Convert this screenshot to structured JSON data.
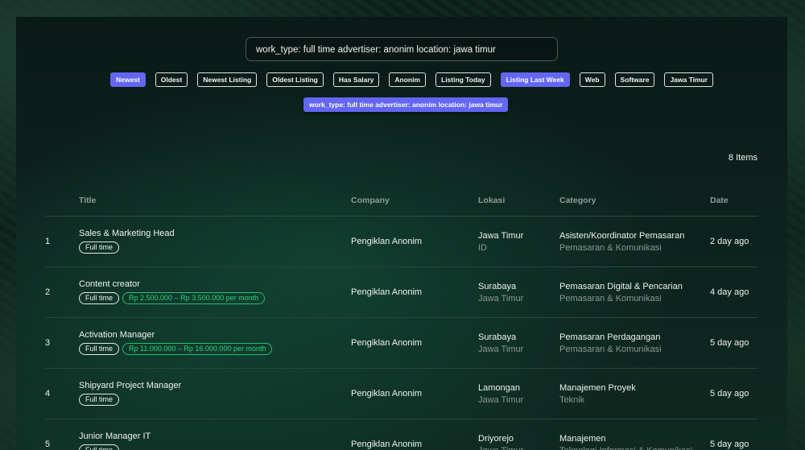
{
  "search": {
    "value": "work_type: full time advertiser: anonim location: jawa timur"
  },
  "chips": [
    {
      "label": "Newest",
      "active": true
    },
    {
      "label": "Oldest",
      "active": false
    },
    {
      "label": "Newest Listing",
      "active": false
    },
    {
      "label": "Oldest Listing",
      "active": false
    },
    {
      "label": "Has Salary",
      "active": false
    },
    {
      "label": "Anonim",
      "active": false
    },
    {
      "label": "Listing Today",
      "active": false
    },
    {
      "label": "Listing Last Week",
      "active": true
    },
    {
      "label": "Web",
      "active": false
    },
    {
      "label": "Software",
      "active": false
    },
    {
      "label": "Jawa Timur",
      "active": false
    }
  ],
  "active_filter": "work_type: full time advertiser: anonim location: jawa timur",
  "items_count": "8 Items",
  "columns": {
    "title": "Title",
    "company": "Company",
    "lokasi": "Lokasi",
    "category": "Category",
    "date": "Date"
  },
  "rows": [
    {
      "num": "1",
      "title": "Sales & Marketing Head",
      "badges": [
        "Full time"
      ],
      "salary": "",
      "company": "Pengiklan Anonim",
      "location": "Jawa Timur",
      "location_sub": "ID",
      "category": "Asisten/Koordinator Pemasaran",
      "category_sub": "Pemasaran & Komunikasi",
      "date": "2 day ago"
    },
    {
      "num": "2",
      "title": "Content creator",
      "badges": [
        "Full time"
      ],
      "salary": "Rp 2.500.000 – Rp 3.500.000 per month",
      "company": "Pengiklan Anonim",
      "location": "Surabaya",
      "location_sub": "Jawa Timur",
      "category": "Pemasaran Digital & Pencarian",
      "category_sub": "Pemasaran & Komunikasi",
      "date": "4 day ago"
    },
    {
      "num": "3",
      "title": "Activation Manager",
      "badges": [
        "Full time"
      ],
      "salary": "Rp 11.000.000 – Rp 16.000.000 per month",
      "company": "Pengiklan Anonim",
      "location": "Surabaya",
      "location_sub": "Jawa Timur",
      "category": "Pemasaran Perdagangan",
      "category_sub": "Pemasaran & Komunikasi",
      "date": "5 day ago"
    },
    {
      "num": "4",
      "title": "Shipyard Project Manager",
      "badges": [
        "Full time"
      ],
      "salary": "",
      "company": "Pengiklan Anonim",
      "location": "Lamongan",
      "location_sub": "Jawa Timur",
      "category": "Manajemen Proyek",
      "category_sub": "Teknik",
      "date": "5 day ago"
    },
    {
      "num": "5",
      "title": "Junior Manager IT",
      "badges": [
        "Full time"
      ],
      "salary": "",
      "company": "Pengiklan Anonim",
      "location": "Driyorejo",
      "location_sub": "Jawa Timur",
      "category": "Manajemen",
      "category_sub": "Teknologi Informasi & Komunikasi",
      "date": "5 day ago"
    }
  ],
  "colors": {
    "accent": "#6366f1",
    "salary": "#22c06e"
  }
}
